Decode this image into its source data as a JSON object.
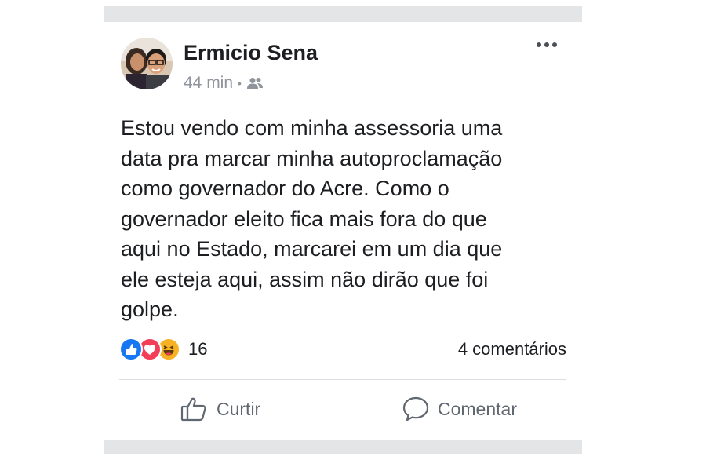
{
  "post": {
    "author": "Ermicio Sena",
    "time": "44 min",
    "audience_icon": "friends-icon",
    "body": "Estou vendo com minha assessoria uma\ndata pra marcar minha autoproclamação\ncomo governador do Acre. Como o\ngovernador eleito fica mais fora do que\naqui no Estado, marcarei em um dia que\nele esteja aqui, assim não dirão que foi\ngolpe.",
    "reactions": {
      "icons": [
        "like-icon",
        "love-icon",
        "haha-icon"
      ],
      "count": "16"
    },
    "comments_label": "4 comentários",
    "actions": {
      "like_label": "Curtir",
      "comment_label": "Comentar"
    }
  },
  "colors": {
    "like": "#1877f2",
    "love": "#f33e58",
    "haha": "#f7b125",
    "muted": "#606770"
  }
}
